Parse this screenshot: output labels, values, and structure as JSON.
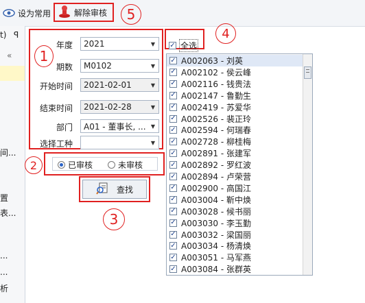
{
  "toolbar": {
    "set_common_label": "设为常用",
    "unaudit_label": "解除审核",
    "annotation_5": "5"
  },
  "leftstrip": {
    "top_text": "t)",
    "pin_glyph": "ꟼ",
    "collapse_glyph": "«",
    "items": [
      "间...",
      "置",
      "表...",
      "...",
      "...",
      "析"
    ]
  },
  "form": {
    "annotation_1": "1",
    "year_label": "年度",
    "year_value": "2021",
    "period_label": "期数",
    "period_value": "M0102",
    "start_label": "开始时间",
    "start_value": "2021-02-01",
    "end_label": "结束时间",
    "end_value": "2021-02-28",
    "dept_label": "部门",
    "dept_value": "A01 - 董事长, ...",
    "worktype_label": "选择工种",
    "worktype_value": ""
  },
  "audit": {
    "annotation_2": "2",
    "audited_label": "已审核",
    "unaudited_label": "未审核",
    "selected": "已审核"
  },
  "search": {
    "annotation_3": "3",
    "label": "查找"
  },
  "select_all": {
    "annotation_4": "4",
    "label": "全选",
    "checked": true
  },
  "employees": [
    "A002063 - 刘英",
    "A002102 - 侯云峰",
    "A002116 - 钱贵法",
    "A002147 - 鲁勤生",
    "A002419 - 苏爱华",
    "A002526 - 裴正玲",
    "A002594 - 何瑞春",
    "A002728 - 柳桂梅",
    "A002891 - 张建军",
    "A002892 - 罗红波",
    "A002894 - 卢荣营",
    "A002900 - 高国江",
    "A003004 - 靳中焕",
    "A003028 - 候书丽",
    "A003030 - 李玉勤",
    "A003032 - 梁国丽",
    "A003034 - 杨清焕",
    "A003051 - 马军燕",
    "A003084 - 张群英"
  ],
  "colors": {
    "annotation_red": "#e02020",
    "accent_blue": "#2a63c8"
  }
}
